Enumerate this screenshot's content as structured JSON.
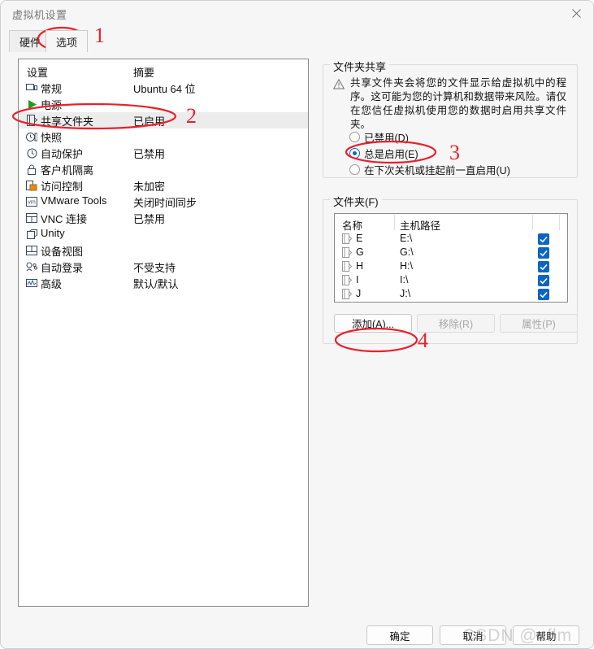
{
  "window": {
    "title": "虚拟机设置",
    "close_icon": "close-icon"
  },
  "tabs": [
    {
      "label": "硬件",
      "active": false
    },
    {
      "label": "选项",
      "active": true
    }
  ],
  "settings_list": {
    "headers": {
      "name": "设置",
      "summary": "摘要"
    },
    "rows": [
      {
        "icon": "monitor-icon",
        "label": "常规",
        "summary": "Ubuntu 64 位",
        "selected": false
      },
      {
        "icon": "power-play-icon",
        "label": "电源",
        "summary": "",
        "selected": false
      },
      {
        "icon": "shared-folder-icon",
        "label": "共享文件夹",
        "summary": "已启用",
        "selected": true
      },
      {
        "icon": "snapshot-clock-icon",
        "label": "快照",
        "summary": "",
        "selected": false
      },
      {
        "icon": "autoprotect-icon",
        "label": "自动保护",
        "summary": "已禁用",
        "selected": false
      },
      {
        "icon": "lock-icon",
        "label": "客户机隔离",
        "summary": "",
        "selected": false
      },
      {
        "icon": "access-control-icon",
        "label": "访问控制",
        "summary": "未加密",
        "selected": false
      },
      {
        "icon": "vmware-tools-icon",
        "label": "VMware Tools",
        "summary": "关闭时间同步",
        "selected": false
      },
      {
        "icon": "vnc-icon",
        "label": "VNC 连接",
        "summary": "已禁用",
        "selected": false
      },
      {
        "icon": "unity-icon",
        "label": "Unity",
        "summary": "",
        "selected": false
      },
      {
        "icon": "device-view-icon",
        "label": "设备视图",
        "summary": "",
        "selected": false
      },
      {
        "icon": "autologin-icon",
        "label": "自动登录",
        "summary": "不受支持",
        "selected": false
      },
      {
        "icon": "advanced-icon",
        "label": "高级",
        "summary": "默认/默认",
        "selected": false
      }
    ]
  },
  "folder_sharing": {
    "group_title": "文件夹共享",
    "warning_icon": "warning-triangle-icon",
    "warning_text": "共享文件夹会将您的文件显示给虚拟机中的程序。这可能为您的计算机和数据带来风险。请仅在您信任虚拟机使用您的数据时启用共享文件夹。",
    "options": [
      {
        "label": "已禁用(D)",
        "checked": false
      },
      {
        "label": "总是启用(E)",
        "checked": true
      },
      {
        "label": "在下次关机或挂起前一直启用(U)",
        "checked": false
      }
    ]
  },
  "folders": {
    "group_title": "文件夹(F)",
    "columns": [
      "名称",
      "主机路径"
    ],
    "rows": [
      {
        "icon": "folder-icon",
        "name": "E",
        "path": "E:\\",
        "enabled": true
      },
      {
        "icon": "folder-icon",
        "name": "G",
        "path": "G:\\",
        "enabled": true
      },
      {
        "icon": "folder-icon",
        "name": "H",
        "path": "H:\\",
        "enabled": true
      },
      {
        "icon": "folder-icon",
        "name": "I",
        "path": "I:\\",
        "enabled": true
      },
      {
        "icon": "folder-icon",
        "name": "J",
        "path": "J:\\",
        "enabled": true
      }
    ],
    "buttons": {
      "add": "添加(A)...",
      "remove": "移除(R)",
      "properties": "属性(P)"
    }
  },
  "dialog_buttons": {
    "ok": "确定",
    "cancel": "取消",
    "help": "帮助"
  },
  "annotations": {
    "accent_color": "#e8212c",
    "markers": [
      "1",
      "2",
      "3",
      "4"
    ]
  },
  "watermark": {
    "text": "CSDN @xflm"
  }
}
